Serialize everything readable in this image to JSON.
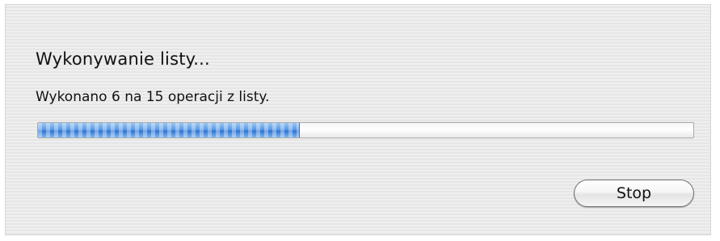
{
  "dialog": {
    "title": "Wykonywanie listy...",
    "status": "Wykonano 6 na 15 operacji z listy.",
    "progress": {
      "completed": 6,
      "total": 15,
      "fraction": 0.4
    },
    "stop_label": "Stop"
  },
  "colors": {
    "progress_fill": "#5a9be6",
    "dialog_background": "#ececec"
  }
}
